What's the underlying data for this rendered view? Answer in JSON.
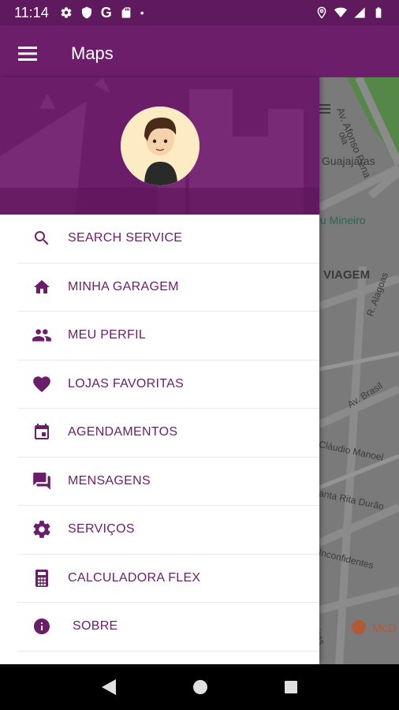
{
  "status_bar": {
    "time": "11:14",
    "left_icons": [
      "gear-icon",
      "shield-icon",
      "google-icon",
      "sd-card-icon",
      "dot-icon"
    ],
    "google_letter": "G",
    "dot": "•",
    "right_icons": [
      "location-icon",
      "wifi-icon",
      "signal-icon",
      "battery-icon"
    ]
  },
  "app_bar": {
    "title": "Maps",
    "menu_icon": "menu-icon"
  },
  "map": {
    "labels": {
      "av_afonso_pena": "Av. Afonso Pena",
      "guajajaras_prefix": "ola",
      "guajajaras": "Guajajaras",
      "mineiro": "u Mineiro",
      "viagem": "VIAGEM",
      "alagoas": "R. Alagoas",
      "brasil": "Av. Brasil",
      "claudio_manoel": "Cláudio Manoel",
      "santa_rita": "anta Rita Durão",
      "inconfidentes": "Inconfidentes",
      "timbiras": "imbiras",
      "mcd": "McD"
    }
  },
  "drawer": {
    "avatar_icon": "user-avatar",
    "items": [
      {
        "label": "SEARCH SERVICE",
        "icon": "search-icon"
      },
      {
        "label": "MINHA GARAGEM",
        "icon": "home-icon"
      },
      {
        "label": "MEU PERFIL",
        "icon": "people-icon"
      },
      {
        "label": "LOJAS FAVORITAS",
        "icon": "heart-icon"
      },
      {
        "label": "AGENDAMENTOS",
        "icon": "calendar-icon"
      },
      {
        "label": "MENSAGENS",
        "icon": "messages-icon"
      },
      {
        "label": "SERVIÇOS",
        "icon": "gear-icon"
      },
      {
        "label": "CALCULADORA FLEX",
        "icon": "calculator-icon"
      },
      {
        "label": "SOBRE",
        "icon": "info-icon"
      }
    ]
  },
  "nav_bar": {
    "back": "back-icon",
    "home": "home-circle-icon",
    "recents": "recents-icon"
  },
  "colors": {
    "brand": "#6b1d69",
    "status_bar": "#5e1a5c",
    "menu_text": "#6b1d69"
  }
}
